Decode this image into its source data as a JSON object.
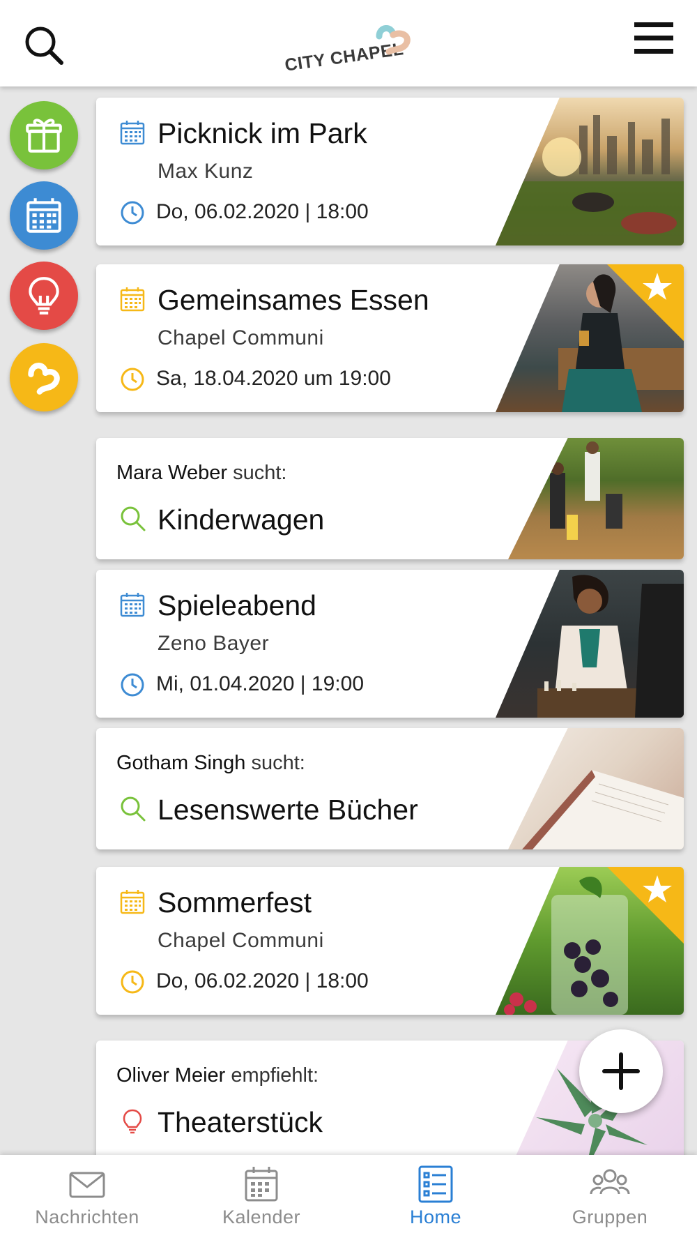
{
  "header": {
    "logo_text": "CITY CHAPEL",
    "search_icon": "search-icon",
    "menu_icon": "hamburger-menu-icon"
  },
  "side_buttons": [
    {
      "name": "gift-icon",
      "color": "#79c23b"
    },
    {
      "name": "calendar-icon",
      "color": "#3d8bd3"
    },
    {
      "name": "lightbulb-icon",
      "color": "#e44a46"
    },
    {
      "name": "city-chapel-logo-icon",
      "color": "#f6b817"
    }
  ],
  "colors": {
    "event_blue": "#3d8bd3",
    "event_yellow": "#f6b817",
    "search_green": "#79c23b",
    "recommend_red": "#e44a46",
    "nav_active": "#2a7fd4",
    "nav_inactive": "#8c8c8c"
  },
  "feed": [
    {
      "type": "event",
      "title": "Picknick im Park",
      "organizer": "Max Kunz",
      "date": "Do, 06.02.2020 | 18:00",
      "accent": "#3d8bd3",
      "featured": false
    },
    {
      "type": "event",
      "title": "Gemeinsames Essen",
      "organizer": "Chapel Communi",
      "date": "Sa, 18.04.2020 um 19:00",
      "accent": "#f6b817",
      "featured": true
    },
    {
      "type": "search",
      "person": "Mara Weber",
      "verb": "sucht:",
      "title": "Kinderwagen"
    },
    {
      "type": "event",
      "title": "Spieleabend",
      "organizer": "Zeno Bayer",
      "date": "Mi, 01.04.2020 | 19:00",
      "accent": "#3d8bd3",
      "featured": false
    },
    {
      "type": "search",
      "person": "Gotham Singh",
      "verb": "sucht:",
      "title": "Lesenswerte Bücher"
    },
    {
      "type": "event",
      "title": "Sommerfest",
      "organizer": "Chapel Communi",
      "date": "Do, 06.02.2020 | 18:00",
      "accent": "#f6b817",
      "featured": true
    },
    {
      "type": "recommendation",
      "person": "Oliver Meier",
      "verb": "empfiehlt:",
      "title": "Theaterstück"
    }
  ],
  "fab": {
    "icon": "plus-icon"
  },
  "bottom_nav": [
    {
      "label": "Nachrichten",
      "icon": "envelope-icon",
      "active": false
    },
    {
      "label": "Kalender",
      "icon": "calendar-icon",
      "active": false
    },
    {
      "label": "Home",
      "icon": "list-icon",
      "active": true
    },
    {
      "label": "Gruppen",
      "icon": "group-icon",
      "active": false
    }
  ]
}
